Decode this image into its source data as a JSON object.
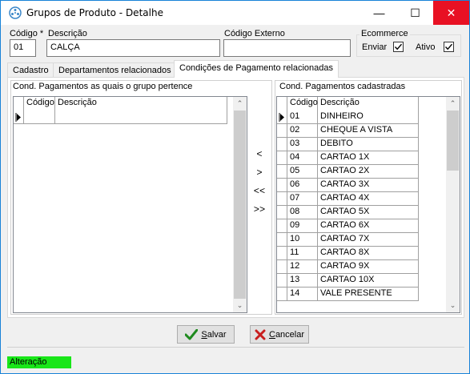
{
  "window": {
    "title": "Grupos de Produto - Detalhe",
    "minimize": "—",
    "maximize": "☐",
    "close": "✕"
  },
  "form": {
    "codigo_label": "Código *",
    "codigo_value": "01",
    "descricao_label": "Descrição",
    "descricao_value": "CALÇA",
    "codigo_externo_label": "Código Externo",
    "codigo_externo_value": "",
    "ecommerce_label": "Ecommerce",
    "enviar_label": "Enviar",
    "enviar_checked": true,
    "ativo_label": "Ativo",
    "ativo_checked": true
  },
  "tabs": [
    {
      "label": "Cadastro"
    },
    {
      "label": "Departamentos relacionados"
    },
    {
      "label": "Condições de Pagamento relacionadas"
    }
  ],
  "left_panel": {
    "title": "Cond. Pagamentos as quais o grupo pertence",
    "columns": [
      "Código",
      "Descrição"
    ]
  },
  "right_panel": {
    "title": "Cond. Pagamentos cadastradas",
    "columns": [
      "Código",
      "Descrição"
    ],
    "rows": [
      {
        "codigo": "01",
        "descricao": "DINHEIRO"
      },
      {
        "codigo": "02",
        "descricao": "CHEQUE A VISTA"
      },
      {
        "codigo": "03",
        "descricao": "DEBITO"
      },
      {
        "codigo": "04",
        "descricao": "CARTAO 1X"
      },
      {
        "codigo": "05",
        "descricao": "CARTAO 2X"
      },
      {
        "codigo": "06",
        "descricao": "CARTAO 3X"
      },
      {
        "codigo": "07",
        "descricao": "CARTAO 4X"
      },
      {
        "codigo": "08",
        "descricao": "CARTAO 5X"
      },
      {
        "codigo": "09",
        "descricao": "CARTAO 6X"
      },
      {
        "codigo": "10",
        "descricao": "CARTAO 7X"
      },
      {
        "codigo": "11",
        "descricao": "CARTAO 8X"
      },
      {
        "codigo": "12",
        "descricao": "CARTAO 9X"
      },
      {
        "codigo": "13",
        "descricao": "CARTAO 10X"
      },
      {
        "codigo": "14",
        "descricao": "VALE PRESENTE"
      }
    ]
  },
  "transfer_buttons": {
    "move_one_left": "<",
    "move_one_right": ">",
    "move_all_left": "<<",
    "move_all_right": ">>"
  },
  "buttons": {
    "salvar": "Salvar",
    "cancelar": "Cancelar"
  },
  "status": {
    "mode": "Alteração",
    "color": "#19e619"
  }
}
